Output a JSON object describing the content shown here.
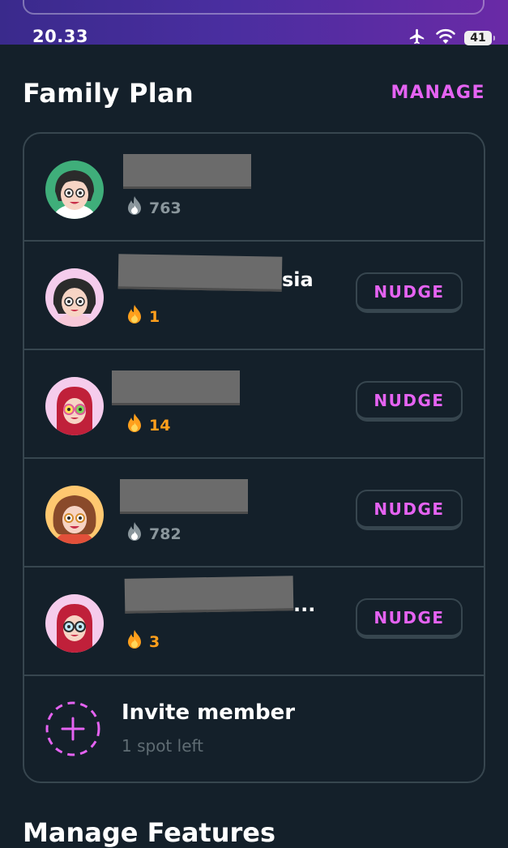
{
  "status_bar": {
    "time": "20.33",
    "battery": "41",
    "icons": [
      "airplane-icon",
      "wifi-icon",
      "battery-icon"
    ]
  },
  "section": {
    "title": "Family Plan",
    "manage_label": "MANAGE"
  },
  "members": [
    {
      "name_visible_suffix": "",
      "streak": "763",
      "streak_color": "gray",
      "has_nudge": false
    },
    {
      "name_visible_suffix": "sia",
      "streak": "1",
      "streak_color": "orange",
      "has_nudge": true
    },
    {
      "name_visible_suffix": "",
      "streak": "14",
      "streak_color": "orange",
      "has_nudge": true
    },
    {
      "name_visible_suffix": "",
      "streak": "782",
      "streak_color": "gray",
      "has_nudge": true
    },
    {
      "name_visible_suffix": "...",
      "streak": "3",
      "streak_color": "orange",
      "has_nudge": true
    }
  ],
  "nudge_label": "NUDGE",
  "invite": {
    "title": "Invite member",
    "subtitle": "1 spot left"
  },
  "next_section_title": "Manage Features",
  "colors": {
    "background": "#14202a",
    "accent": "#e563f2",
    "border": "#37464f",
    "streak_active": "#ff9f1c",
    "streak_inactive": "#8a969c"
  }
}
